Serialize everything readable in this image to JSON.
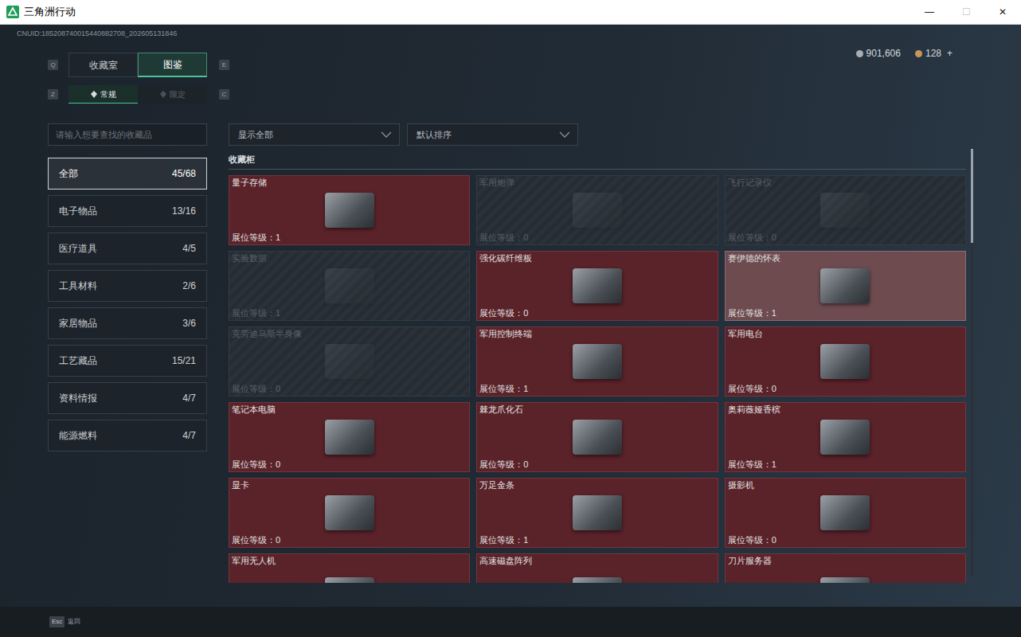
{
  "window": {
    "title": "三角洲行动",
    "controls": [
      {
        "glyph": "—",
        "disabled": false
      },
      {
        "glyph": "☐",
        "disabled": true
      },
      {
        "glyph": "✕",
        "disabled": false
      }
    ]
  },
  "uid": "CNUID:185208740015440882708_202605131846",
  "currency": [
    {
      "value": "901,606",
      "color": "#a7adb3",
      "action": ""
    },
    {
      "value": "128",
      "color": "#c9955a",
      "action": "+"
    }
  ],
  "tabs": [
    {
      "label": "收藏室",
      "selected": false
    },
    {
      "label": "图鉴",
      "selected": true
    }
  ],
  "tab_keys": [
    "Q",
    "E"
  ],
  "subtabs": [
    {
      "label": "常规",
      "selected": true
    },
    {
      "label": "限定",
      "selected": false
    }
  ],
  "subtab_keys": [
    "Z",
    "C"
  ],
  "search": {
    "placeholder": "请输入想要查找的收藏品"
  },
  "categories": [
    {
      "label": "全部",
      "count": "45/68",
      "selected": true
    },
    {
      "label": "电子物品",
      "count": "13/16",
      "selected": false
    },
    {
      "label": "医疗道具",
      "count": "4/5",
      "selected": false
    },
    {
      "label": "工具材料",
      "count": "2/6",
      "selected": false
    },
    {
      "label": "家居物品",
      "count": "3/6",
      "selected": false
    },
    {
      "label": "工艺藏品",
      "count": "15/21",
      "selected": false
    },
    {
      "label": "资料情报",
      "count": "4/7",
      "selected": false
    },
    {
      "label": "能源燃料",
      "count": "4/7",
      "selected": false
    }
  ],
  "filters": [
    {
      "label": "显示全部"
    },
    {
      "label": "默认排序"
    }
  ],
  "section": "收藏柜",
  "rank_label": "展位等级：",
  "items": [
    {
      "name": "量子存储",
      "rank": "1",
      "owned": true,
      "selected": false
    },
    {
      "name": "军用炮弹",
      "rank": "0",
      "owned": false,
      "selected": false
    },
    {
      "name": "飞行记录仪",
      "rank": "0",
      "owned": false,
      "selected": false
    },
    {
      "name": "实验数据",
      "rank": "1",
      "owned": false,
      "selected": false
    },
    {
      "name": "强化碳纤维板",
      "rank": "0",
      "owned": true,
      "selected": false
    },
    {
      "name": "赛伊德的怀表",
      "rank": "1",
      "owned": true,
      "selected": true
    },
    {
      "name": "克劳迪乌斯半身像",
      "rank": "0",
      "owned": false,
      "selected": false
    },
    {
      "name": "军用控制终端",
      "rank": "1",
      "owned": true,
      "selected": false
    },
    {
      "name": "军用电台",
      "rank": "0",
      "owned": true,
      "selected": false
    },
    {
      "name": "笔记本电脑",
      "rank": "0",
      "owned": true,
      "selected": false
    },
    {
      "name": "棘龙爪化石",
      "rank": "0",
      "owned": true,
      "selected": false
    },
    {
      "name": "奥莉薇娅香槟",
      "rank": "1",
      "owned": true,
      "selected": false
    },
    {
      "name": "显卡",
      "rank": "0",
      "owned": true,
      "selected": false
    },
    {
      "name": "万足金条",
      "rank": "1",
      "owned": true,
      "selected": false
    },
    {
      "name": "摄影机",
      "rank": "0",
      "owned": true,
      "selected": false
    },
    {
      "name": "军用无人机",
      "owned": true,
      "selected": false
    },
    {
      "name": "高速磁盘阵列",
      "owned": true,
      "selected": false
    },
    {
      "name": "刀片服务器",
      "owned": true,
      "selected": false
    }
  ],
  "scrollbar": {
    "level": 0.22
  },
  "footer": {
    "key": "Esc",
    "label": "返回"
  }
}
